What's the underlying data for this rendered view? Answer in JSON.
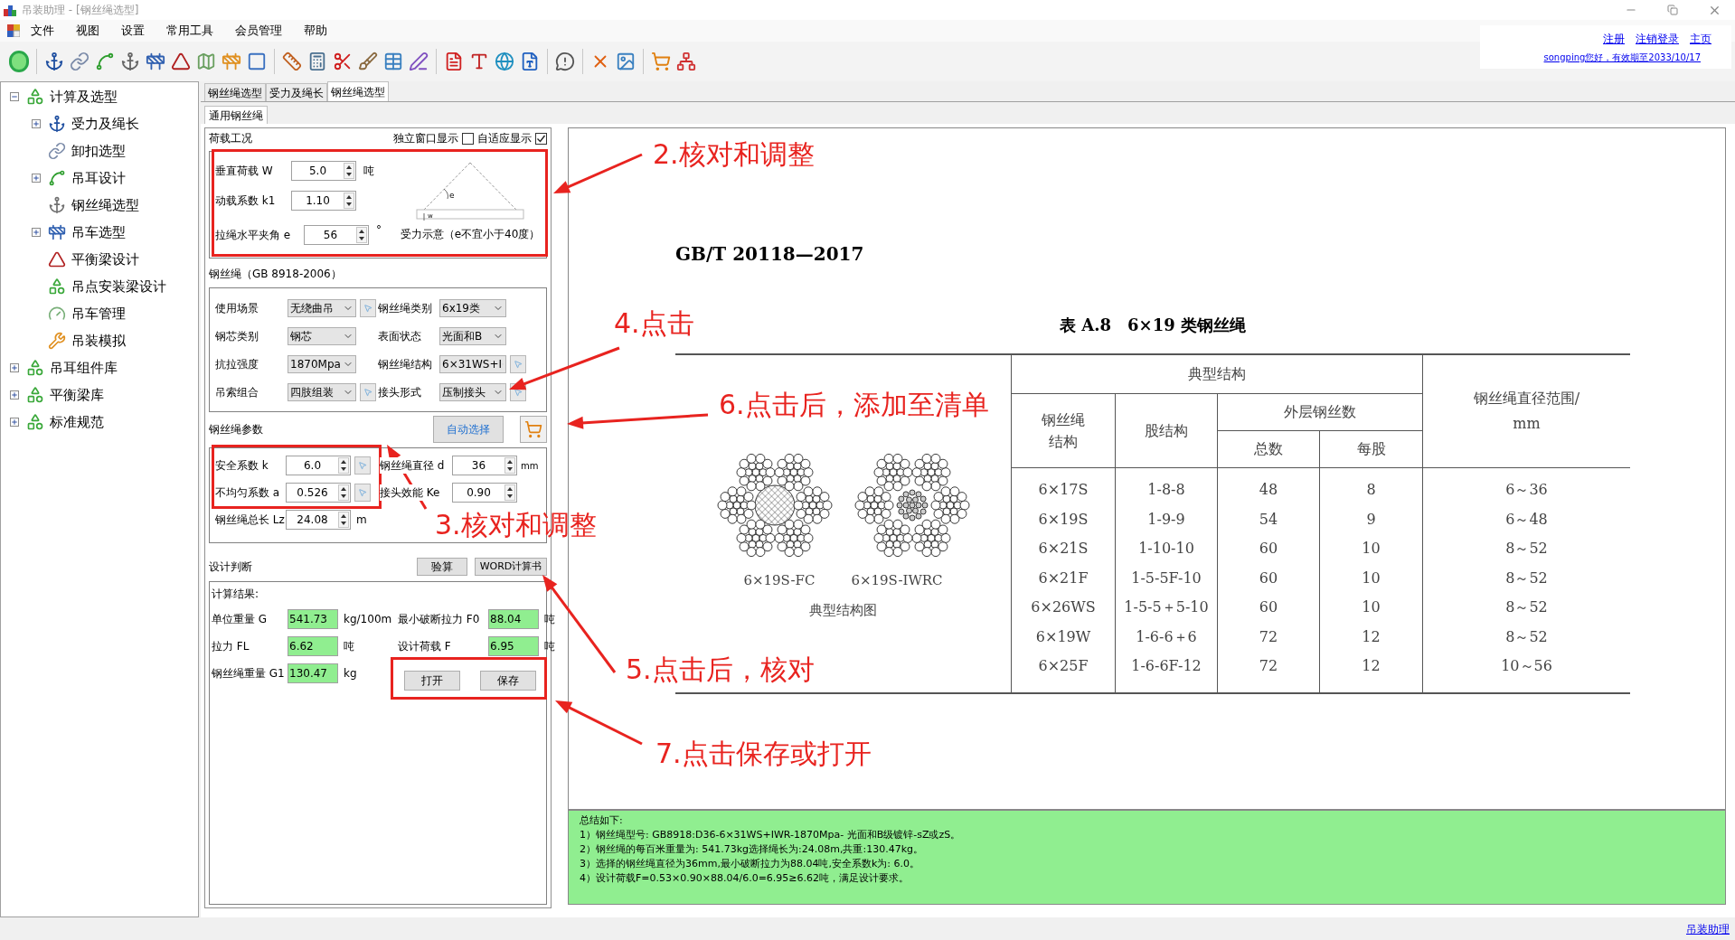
{
  "window": {
    "title": "吊装助理 - [钢丝绳选型]"
  },
  "menu": [
    "文件",
    "视图",
    "设置",
    "常用工具",
    "会员管理",
    "帮助"
  ],
  "account": {
    "links": [
      "注册",
      "注销登录",
      "主页"
    ],
    "status": "songping您好，有效期至2033/10/17"
  },
  "tree": [
    {
      "label": "计算及选型",
      "kind": "branch",
      "expanded": true,
      "children": [
        {
          "label": "受力及绳长",
          "kind": "branch",
          "expanded": false
        },
        {
          "label": "卸扣选型",
          "kind": "leaf"
        },
        {
          "label": "吊耳设计",
          "kind": "branch",
          "expanded": false
        },
        {
          "label": "钢丝绳选型",
          "kind": "leaf"
        },
        {
          "label": "吊车选型",
          "kind": "branch",
          "expanded": false
        },
        {
          "label": "平衡梁设计",
          "kind": "leaf"
        },
        {
          "label": "吊点安装梁设计",
          "kind": "leaf"
        },
        {
          "label": "吊车管理",
          "kind": "leaf"
        },
        {
          "label": "吊装模拟",
          "kind": "leaf"
        }
      ]
    },
    {
      "label": "吊耳组件库",
      "kind": "branch",
      "expanded": false
    },
    {
      "label": "平衡梁库",
      "kind": "branch",
      "expanded": false
    },
    {
      "label": "标准规范",
      "kind": "branch",
      "expanded": false
    }
  ],
  "tabs": [
    {
      "label": "钢丝绳选型",
      "selected": false
    },
    {
      "label": "受力及绳长",
      "selected": false
    },
    {
      "label": "钢丝绳选型",
      "selected": true
    }
  ],
  "subtabs": [
    {
      "label": "通用钢丝绳",
      "selected": true
    }
  ],
  "load": {
    "title": "荷载工况",
    "options": [
      {
        "label": "独立窗口显示",
        "checked": false
      },
      {
        "label": "自适应显示",
        "checked": true
      }
    ],
    "fields": [
      {
        "label": "垂直荷载 W",
        "value": "5.0",
        "unit": "吨"
      },
      {
        "label": "动载系数 k1",
        "value": "1.10"
      },
      {
        "label": "拉绳水平夹角 e",
        "value": "56",
        "unit": "°"
      }
    ],
    "diagram_labels": [
      "e",
      "w"
    ],
    "diagram_caption": "受力示意（e不宜小于40度）"
  },
  "rope": {
    "title": "钢丝绳（GB  8918-2006）",
    "left": [
      {
        "label": "使用场景",
        "value": "无绕曲吊",
        "lookup": true
      },
      {
        "label": "钢芯类别",
        "value": "钢芯",
        "lookup": false
      },
      {
        "label": "抗拉强度",
        "value": "1870Mpa",
        "lookup": false
      },
      {
        "label": "吊索组合",
        "value": "四肢组装",
        "lookup": true
      }
    ],
    "right": [
      {
        "label": "钢丝绳类别",
        "value": "6x19类",
        "lookup": false
      },
      {
        "label": "表面状态",
        "value": "光面和B",
        "lookup": false
      },
      {
        "label": "钢丝绳结构",
        "value": "6×31WS+I",
        "lookup": true
      },
      {
        "label": "接头形式",
        "value": "压制接头",
        "lookup": true
      }
    ]
  },
  "params": {
    "title": "钢丝绳参数",
    "auto_button": "自动选择",
    "left": [
      {
        "label": "安全系数 k",
        "value": "6.0",
        "lookup": true
      },
      {
        "label": "不均匀系数 a",
        "value": "0.526",
        "lookup": true
      },
      {
        "label": "钢丝绳总长 Lz",
        "value": "24.08",
        "unit": "m",
        "lookup": false
      }
    ],
    "right": [
      {
        "label": "钢丝绳直径 d",
        "value": "36",
        "unit": "mm"
      },
      {
        "label": "接头效能 Ke",
        "value": "0.90"
      }
    ]
  },
  "design": {
    "title": "设计判断",
    "buttons": [
      "验算",
      "WORD计算书"
    ],
    "results_title": "计算结果:",
    "results": [
      {
        "label": "单位重量 G",
        "value": "541.73",
        "unit": "kg/100m"
      },
      {
        "label": "最小破断拉力 F0",
        "value": "88.04",
        "unit": "吨"
      },
      {
        "label": "拉力 FL",
        "value": "6.62",
        "unit": "吨"
      },
      {
        "label": "设计荷载 F",
        "value": "6.95",
        "unit": "吨"
      },
      {
        "label": "钢丝绳重量 G1",
        "value": "130.47",
        "unit": "kg"
      }
    ],
    "file_buttons": [
      "打开",
      "保存"
    ]
  },
  "document": {
    "standard": "GB/T 20118—2017",
    "table_title": "表 A.8　6×19 类钢丝绳",
    "figure_captions": [
      "6×19S-FC",
      "6×19S-IWRC"
    ],
    "figure_title": "典型结构图",
    "headers": {
      "group": "典型结构",
      "structure": "钢丝绳结构",
      "strand": "股结构",
      "outer": "外层钢丝数",
      "total": "总数",
      "per": "每股",
      "range": [
        "钢丝绳直径范围/",
        "mm"
      ]
    },
    "rows": [
      [
        "6×17S",
        "1-8-8",
        "48",
        "8",
        "6～36"
      ],
      [
        "6×19S",
        "1-9-9",
        "54",
        "9",
        "6～48"
      ],
      [
        "6×21S",
        "1-10-10",
        "60",
        "10",
        "8～52"
      ],
      [
        "6×21F",
        "1-5-5F-10",
        "60",
        "10",
        "8～52"
      ],
      [
        "6×26WS",
        "1-5-5＋5-10",
        "60",
        "10",
        "8～52"
      ],
      [
        "6×19W",
        "1-6-6＋6",
        "72",
        "12",
        "8～52"
      ],
      [
        "6×25F",
        "1-6-6F-12",
        "72",
        "12",
        "10～56"
      ]
    ]
  },
  "summary": {
    "title": "总结如下:",
    "lines": [
      "1）钢丝绳型号: GB8918:D36-6×31WS+IWR-1870Mpa- 光面和B级镀锌-sZ或zS。",
      "2）钢丝绳的每百米重量为: 541.73kg选择绳长为:24.08m,共重:130.47kg。",
      "3）选择的钢丝绳直径为36mm,最小破断拉力为88.04吨,安全系数k为: 6.0。",
      "4）设计荷载F=0.53×0.90×88.04/6.0=6.95≥6.62吨，满足设计要求。"
    ]
  },
  "status_bar": {
    "link": "吊装助理"
  },
  "annotations": [
    "2.核对和调整",
    "4.点击",
    "6.点击后，添加至清单",
    "3.核对和调整",
    "5.点击后，核对",
    "7.点击保存或打开"
  ]
}
